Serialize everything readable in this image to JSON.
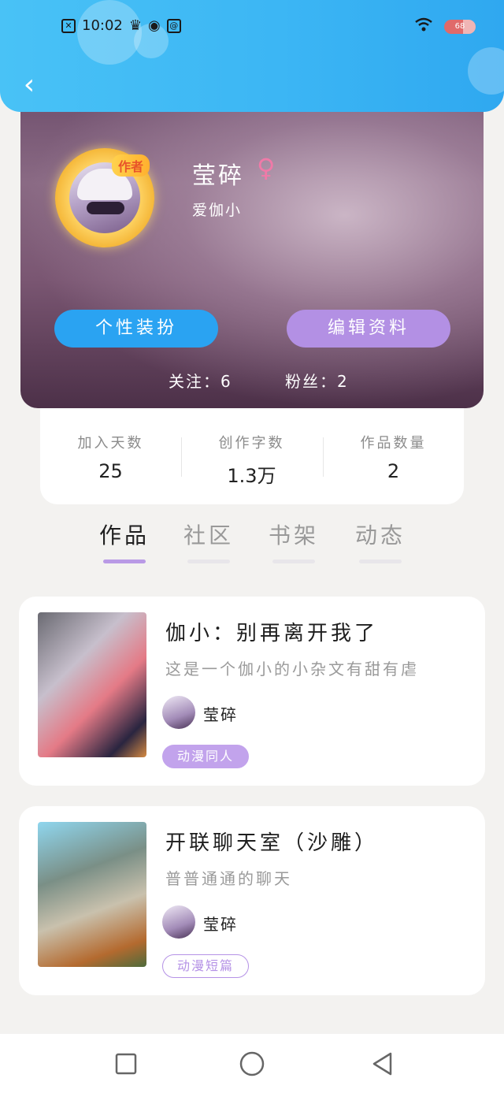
{
  "status_bar": {
    "time": "10:02",
    "battery": "68"
  },
  "profile": {
    "author_tag": "作者",
    "name": "莹碎",
    "gender_symbol": "♀",
    "bio": "爱伽小",
    "dress_button": "个性装扮",
    "edit_button": "编辑资料",
    "following": "关注：6",
    "followers": "粉丝：2"
  },
  "stats": [
    {
      "label": "加入天数",
      "value": "25"
    },
    {
      "label": "创作字数",
      "value": "1.3万"
    },
    {
      "label": "作品数量",
      "value": "2"
    }
  ],
  "tabs": [
    {
      "label": "作品"
    },
    {
      "label": "社区"
    },
    {
      "label": "书架"
    },
    {
      "label": "动态"
    }
  ],
  "works": [
    {
      "title": "伽小：别再离开我了",
      "desc": "这是一个伽小的小杂文有甜有虐",
      "author": "莹碎",
      "tag": "动漫同人"
    },
    {
      "title": "开联聊天室（沙雕）",
      "desc": "普普通通的聊天",
      "author": "莹碎",
      "tag": "动漫短篇"
    }
  ],
  "colors": {
    "header": "#3cb6f4",
    "dress_button": "#2aa3f2",
    "edit_button": "#b390e4",
    "tab_active": "#b99ae6",
    "tag": "#c2a3ec"
  },
  "icons": {
    "back": "chevron-left-icon",
    "gender": "female-icon",
    "nav_recent": "square-icon",
    "nav_home": "circle-icon",
    "nav_back": "triangle-back-icon"
  }
}
